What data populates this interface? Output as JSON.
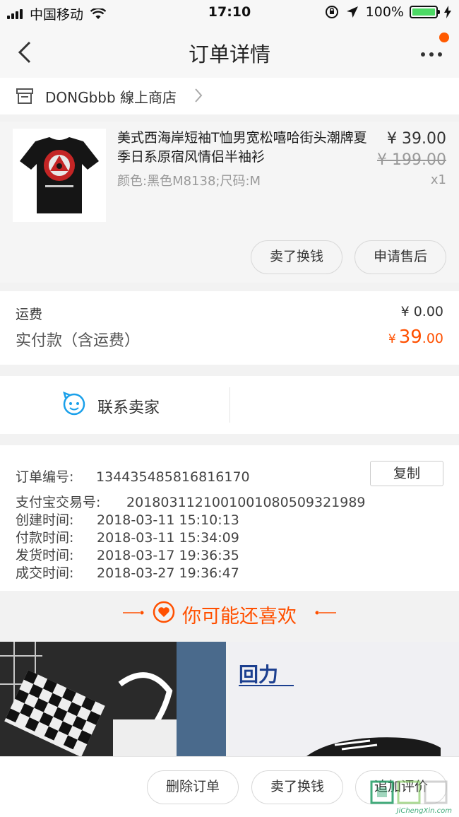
{
  "status_bar": {
    "carrier": "中国移动",
    "time": "17:10",
    "battery": "100%"
  },
  "nav": {
    "title": "订单详情"
  },
  "shop": {
    "name": "DONGbbb 線上商店"
  },
  "item": {
    "title": "美式西海岸短袖T恤男宽松嘻哈街头潮牌夏季日系原宿风情侣半袖衫",
    "sku": "颜色:黑色M8138;尺码:M",
    "price": "¥ 39.00",
    "original_price": "¥ 199.00",
    "quantity": "x1",
    "buttons": {
      "sell": "卖了换钱",
      "after_sale": "申请售后"
    }
  },
  "cost": {
    "shipping_label": "运费",
    "shipping_value": "¥ 0.00",
    "paid_label": "实付款（含运费）",
    "paid_currency": "¥",
    "paid_int": "39",
    "paid_dec": ".00"
  },
  "contact": {
    "label": "联系卖家"
  },
  "order_info": {
    "copy_label": "复制",
    "rows": [
      {
        "key": "订单编号:",
        "value": "134435485816816170"
      },
      {
        "key": "支付宝交易号:",
        "value": "2018031121001001080509321989"
      },
      {
        "key": "创建时间:",
        "value": "2018-03-11 15:10:13"
      },
      {
        "key": "付款时间:",
        "value": "2018-03-11 15:34:09"
      },
      {
        "key": "发货时间:",
        "value": "2018-03-17 19:36:35"
      },
      {
        "key": "成交时间:",
        "value": "2018-03-27 19:36:47"
      }
    ]
  },
  "recommend": {
    "label": "你可能还喜欢",
    "brand_logo": "回力"
  },
  "bottom_bar": {
    "delete": "删除订单",
    "sell": "卖了换钱",
    "review": "追加评价"
  },
  "watermark": {
    "site": "JiChengXin.com"
  },
  "colors": {
    "accent": "#ff5000",
    "battery": "#4cd964",
    "badge": "#ff5a00",
    "icon_blue": "#1aa0ea"
  }
}
